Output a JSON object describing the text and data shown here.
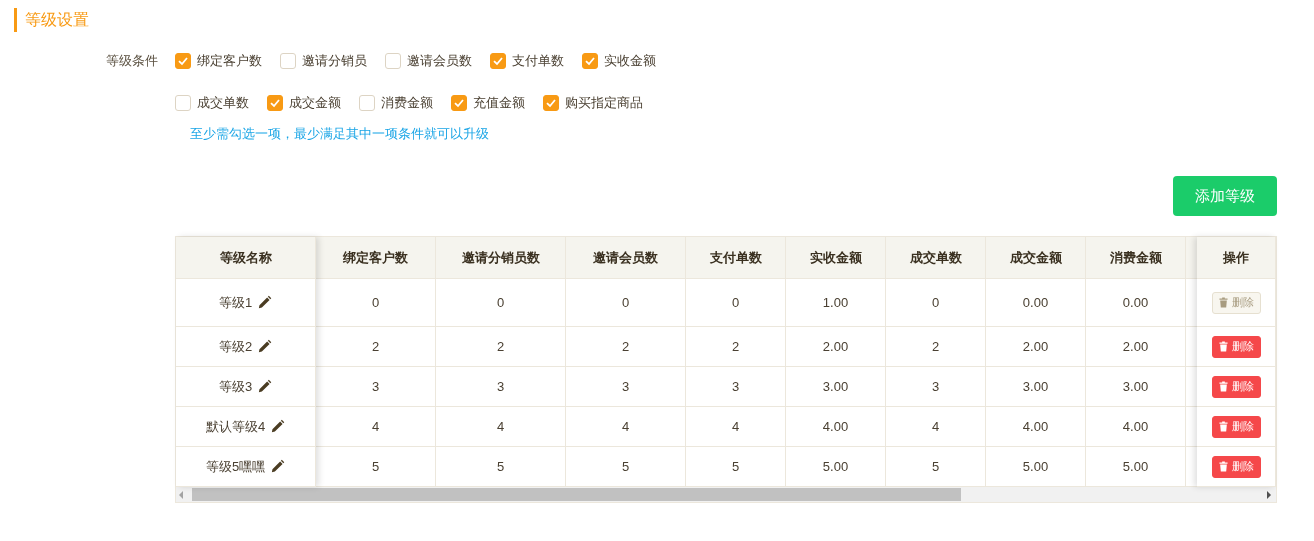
{
  "section_title": "等级设置",
  "conditions": {
    "label": "等级条件",
    "rows": [
      [
        {
          "label": "绑定客户数",
          "checked": true
        },
        {
          "label": "邀请分销员",
          "checked": false
        },
        {
          "label": "邀请会员数",
          "checked": false
        },
        {
          "label": "支付单数",
          "checked": true
        },
        {
          "label": "实收金额",
          "checked": true
        }
      ],
      [
        {
          "label": "成交单数",
          "checked": false
        },
        {
          "label": "成交金额",
          "checked": true
        },
        {
          "label": "消费金额",
          "checked": false
        },
        {
          "label": "充值金额",
          "checked": true
        },
        {
          "label": "购买指定商品",
          "checked": true
        }
      ]
    ],
    "hint": "至少需勾选一项，最少满足其中一项条件就可以升级"
  },
  "add_button": "添加等级",
  "table": {
    "name_column": "等级名称",
    "columns": [
      "绑定客户数",
      "邀请分销员数",
      "邀请会员数",
      "支付单数",
      "实收金额",
      "成交单数",
      "成交金额",
      "消费金额"
    ],
    "action_column": "操作",
    "rows": [
      {
        "name": "等级1",
        "values": [
          "0",
          "0",
          "0",
          "0",
          "1.00",
          "0",
          "0.00",
          "0.00"
        ],
        "delete": {
          "label": "删除",
          "disabled": true
        }
      },
      {
        "name": "等级2",
        "values": [
          "2",
          "2",
          "2",
          "2",
          "2.00",
          "2",
          "2.00",
          "2.00"
        ],
        "delete": {
          "label": "删除",
          "disabled": false
        }
      },
      {
        "name": "等级3",
        "values": [
          "3",
          "3",
          "3",
          "3",
          "3.00",
          "3",
          "3.00",
          "3.00"
        ],
        "delete": {
          "label": "删除",
          "disabled": false
        }
      },
      {
        "name": "默认等级4",
        "values": [
          "4",
          "4",
          "4",
          "4",
          "4.00",
          "4",
          "4.00",
          "4.00"
        ],
        "delete": {
          "label": "删除",
          "disabled": false
        }
      },
      {
        "name": "等级5嘿嘿",
        "values": [
          "5",
          "5",
          "5",
          "5",
          "5.00",
          "5",
          "5.00",
          "5.00"
        ],
        "delete": {
          "label": "删除",
          "disabled": false
        }
      }
    ]
  }
}
